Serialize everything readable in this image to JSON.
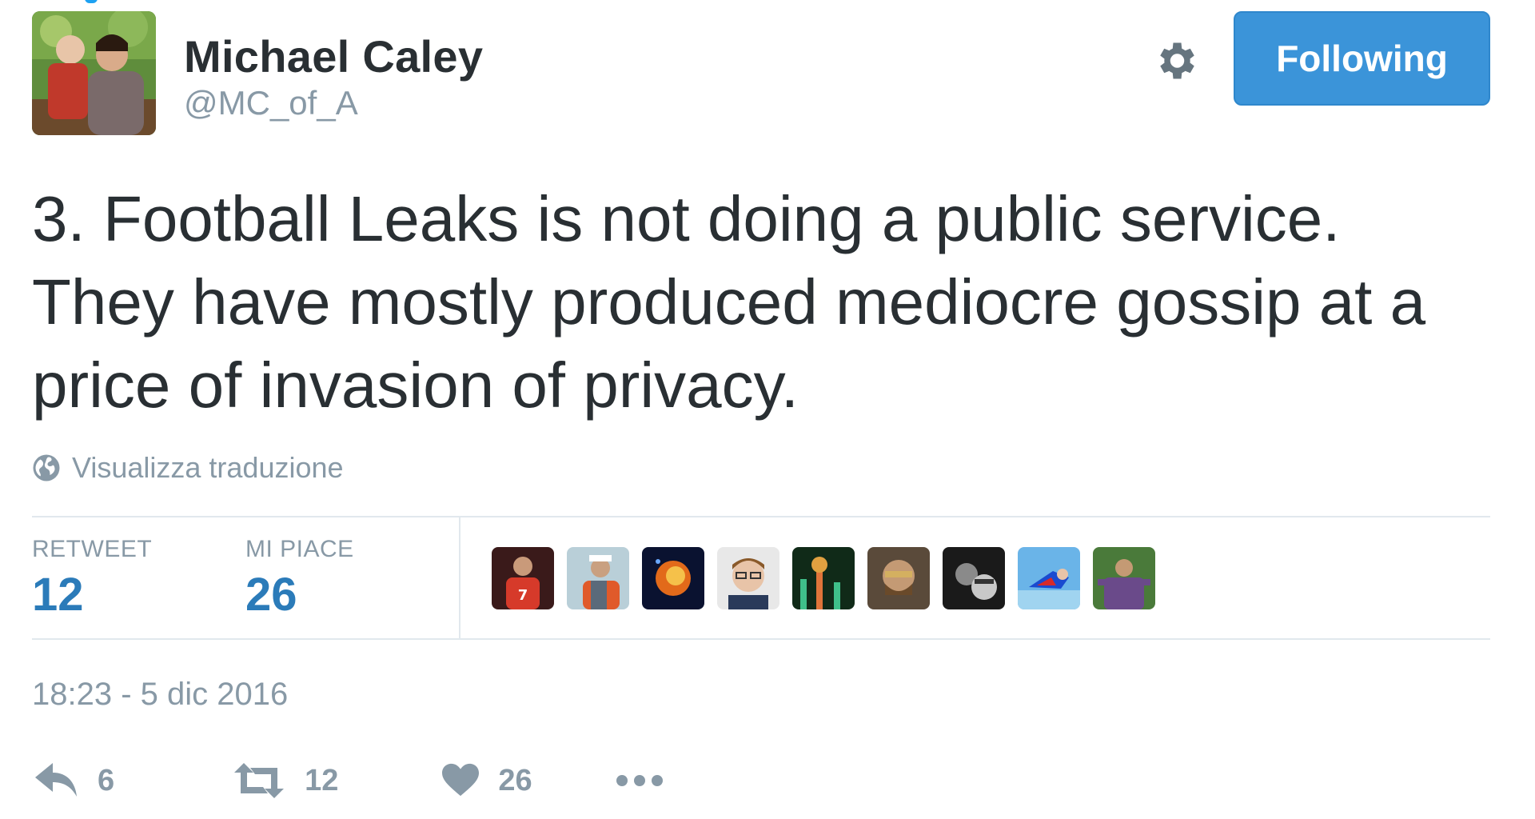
{
  "author": {
    "name": "Michael Caley",
    "handle": "@MC_of_A",
    "avatar_icon": "profile-photo"
  },
  "header": {
    "settings_icon": "gear-icon",
    "follow_label": "Following"
  },
  "tweet": {
    "lines": [
      "3. Football Leaks is not doing a public service.",
      "They have mostly produced mediocre gossip at a",
      "price of invasion of privacy."
    ],
    "translate_label": "Visualizza traduzione",
    "translate_icon": "globe-icon"
  },
  "stats": {
    "retweet_label": "RETWEET",
    "retweet_count": "12",
    "likes_label": "MI PIACE",
    "likes_count": "26",
    "liker_avatars": [
      "liker-avatar-1",
      "liker-avatar-2",
      "liker-avatar-3",
      "liker-avatar-4",
      "liker-avatar-5",
      "liker-avatar-6",
      "liker-avatar-7",
      "liker-avatar-8",
      "liker-avatar-9"
    ]
  },
  "timestamp": "18:23 - 5 dic 2016",
  "actions": {
    "reply_count": "6",
    "retweet_count": "12",
    "like_count": "26",
    "more_icon": "more-dots-icon"
  },
  "colors": {
    "follow_button": "#3b94d9",
    "stat_value": "#2b7bb9",
    "muted_text": "#8899a6",
    "divider": "#e1e8ed"
  }
}
